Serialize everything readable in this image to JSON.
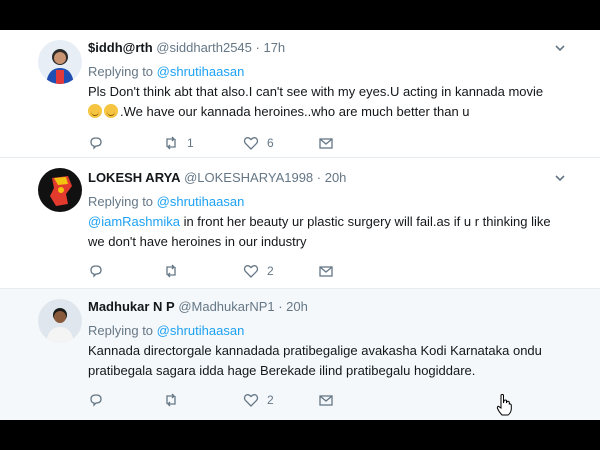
{
  "tweets": [
    {
      "name": "$iddh@rth",
      "handle": "@siddharth2545",
      "time": "17h",
      "replying_prefix": "Replying to",
      "replying_to": "@shrutihaasan",
      "text_line1": "Pls Don't think abt that also.I can't see with my eyes.U acting in kannada movie",
      "text_line2": ".We have our kannada heroines..who are much better than u",
      "retweets": "1",
      "likes": "6",
      "avatar_icon": "user-avatar-icon"
    },
    {
      "name": "LOKESH ARYA",
      "handle": "@LOKESHARYA1998",
      "time": "20h",
      "replying_prefix": "Replying to",
      "replying_to": "@shrutihaasan",
      "mention": "@iamRashmika",
      "text_line1": " in front her beauty ur plastic surgery will fail.as if u r thinking like",
      "text_line2": "we don't have heroines in our industry",
      "retweets": "",
      "likes": "2",
      "avatar_icon": "user-avatar-icon"
    },
    {
      "name": "Madhukar N P",
      "handle": "@MadhukarNP1",
      "time": "20h",
      "replying_prefix": "Replying to",
      "replying_to": "@shrutihaasan",
      "text_line1": "Kannada directorgale kannadada pratibegalige avakasha Kodi Karnataka ondu",
      "text_line2": "pratibegala sagara idda hage Berekade ilind pratibegalu hogiddare.",
      "retweets": "",
      "likes": "2",
      "avatar_icon": "user-avatar-icon"
    }
  ],
  "separator": " · ",
  "colors": {
    "link": "#1da1f2",
    "meta": "#657786",
    "text": "#14171a",
    "highlight_bg": "#f5f8fa",
    "letterbox": "#000000"
  }
}
